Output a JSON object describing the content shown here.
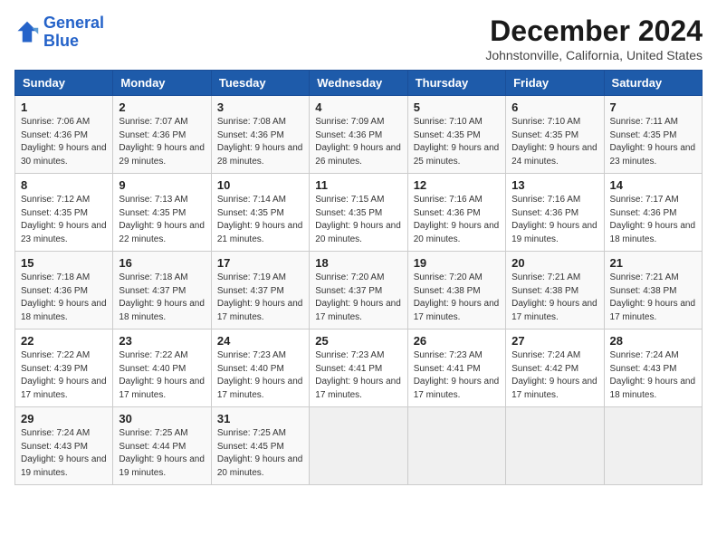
{
  "header": {
    "logo_line1": "General",
    "logo_line2": "Blue",
    "month_title": "December 2024",
    "subtitle": "Johnstonville, California, United States"
  },
  "weekdays": [
    "Sunday",
    "Monday",
    "Tuesday",
    "Wednesday",
    "Thursday",
    "Friday",
    "Saturday"
  ],
  "weeks": [
    [
      {
        "day": "1",
        "sunrise": "7:06 AM",
        "sunset": "4:36 PM",
        "daylight": "9 hours and 30 minutes."
      },
      {
        "day": "2",
        "sunrise": "7:07 AM",
        "sunset": "4:36 PM",
        "daylight": "9 hours and 29 minutes."
      },
      {
        "day": "3",
        "sunrise": "7:08 AM",
        "sunset": "4:36 PM",
        "daylight": "9 hours and 28 minutes."
      },
      {
        "day": "4",
        "sunrise": "7:09 AM",
        "sunset": "4:36 PM",
        "daylight": "9 hours and 26 minutes."
      },
      {
        "day": "5",
        "sunrise": "7:10 AM",
        "sunset": "4:35 PM",
        "daylight": "9 hours and 25 minutes."
      },
      {
        "day": "6",
        "sunrise": "7:10 AM",
        "sunset": "4:35 PM",
        "daylight": "9 hours and 24 minutes."
      },
      {
        "day": "7",
        "sunrise": "7:11 AM",
        "sunset": "4:35 PM",
        "daylight": "9 hours and 23 minutes."
      }
    ],
    [
      {
        "day": "8",
        "sunrise": "7:12 AM",
        "sunset": "4:35 PM",
        "daylight": "9 hours and 23 minutes."
      },
      {
        "day": "9",
        "sunrise": "7:13 AM",
        "sunset": "4:35 PM",
        "daylight": "9 hours and 22 minutes."
      },
      {
        "day": "10",
        "sunrise": "7:14 AM",
        "sunset": "4:35 PM",
        "daylight": "9 hours and 21 minutes."
      },
      {
        "day": "11",
        "sunrise": "7:15 AM",
        "sunset": "4:35 PM",
        "daylight": "9 hours and 20 minutes."
      },
      {
        "day": "12",
        "sunrise": "7:16 AM",
        "sunset": "4:36 PM",
        "daylight": "9 hours and 20 minutes."
      },
      {
        "day": "13",
        "sunrise": "7:16 AM",
        "sunset": "4:36 PM",
        "daylight": "9 hours and 19 minutes."
      },
      {
        "day": "14",
        "sunrise": "7:17 AM",
        "sunset": "4:36 PM",
        "daylight": "9 hours and 18 minutes."
      }
    ],
    [
      {
        "day": "15",
        "sunrise": "7:18 AM",
        "sunset": "4:36 PM",
        "daylight": "9 hours and 18 minutes."
      },
      {
        "day": "16",
        "sunrise": "7:18 AM",
        "sunset": "4:37 PM",
        "daylight": "9 hours and 18 minutes."
      },
      {
        "day": "17",
        "sunrise": "7:19 AM",
        "sunset": "4:37 PM",
        "daylight": "9 hours and 17 minutes."
      },
      {
        "day": "18",
        "sunrise": "7:20 AM",
        "sunset": "4:37 PM",
        "daylight": "9 hours and 17 minutes."
      },
      {
        "day": "19",
        "sunrise": "7:20 AM",
        "sunset": "4:38 PM",
        "daylight": "9 hours and 17 minutes."
      },
      {
        "day": "20",
        "sunrise": "7:21 AM",
        "sunset": "4:38 PM",
        "daylight": "9 hours and 17 minutes."
      },
      {
        "day": "21",
        "sunrise": "7:21 AM",
        "sunset": "4:38 PM",
        "daylight": "9 hours and 17 minutes."
      }
    ],
    [
      {
        "day": "22",
        "sunrise": "7:22 AM",
        "sunset": "4:39 PM",
        "daylight": "9 hours and 17 minutes."
      },
      {
        "day": "23",
        "sunrise": "7:22 AM",
        "sunset": "4:40 PM",
        "daylight": "9 hours and 17 minutes."
      },
      {
        "day": "24",
        "sunrise": "7:23 AM",
        "sunset": "4:40 PM",
        "daylight": "9 hours and 17 minutes."
      },
      {
        "day": "25",
        "sunrise": "7:23 AM",
        "sunset": "4:41 PM",
        "daylight": "9 hours and 17 minutes."
      },
      {
        "day": "26",
        "sunrise": "7:23 AM",
        "sunset": "4:41 PM",
        "daylight": "9 hours and 17 minutes."
      },
      {
        "day": "27",
        "sunrise": "7:24 AM",
        "sunset": "4:42 PM",
        "daylight": "9 hours and 17 minutes."
      },
      {
        "day": "28",
        "sunrise": "7:24 AM",
        "sunset": "4:43 PM",
        "daylight": "9 hours and 18 minutes."
      }
    ],
    [
      {
        "day": "29",
        "sunrise": "7:24 AM",
        "sunset": "4:43 PM",
        "daylight": "9 hours and 19 minutes."
      },
      {
        "day": "30",
        "sunrise": "7:25 AM",
        "sunset": "4:44 PM",
        "daylight": "9 hours and 19 minutes."
      },
      {
        "day": "31",
        "sunrise": "7:25 AM",
        "sunset": "4:45 PM",
        "daylight": "9 hours and 20 minutes."
      },
      null,
      null,
      null,
      null
    ]
  ],
  "labels": {
    "sunrise": "Sunrise:",
    "sunset": "Sunset:",
    "daylight": "Daylight:"
  }
}
